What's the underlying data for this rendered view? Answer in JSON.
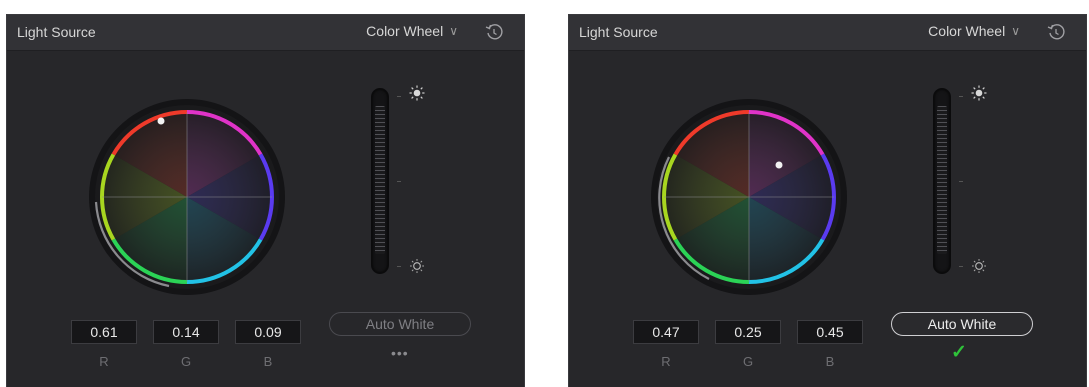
{
  "colors": {
    "panel_bg": "#27272a",
    "header_bg": "#323236",
    "check_color": "#2fc23a"
  },
  "panels": [
    {
      "title": "Light Source",
      "mode": "Color Wheel",
      "values": {
        "r": "0.61",
        "g": "0.14",
        "b": "0.09"
      },
      "channels": {
        "r": "R",
        "g": "G",
        "b": "B"
      },
      "auto_white_label": "Auto White",
      "auto_white_active": false,
      "status_icon": "more-dots-icon",
      "status_text": "•••"
    },
    {
      "title": "Light Source",
      "mode": "Color Wheel",
      "values": {
        "r": "0.47",
        "g": "0.25",
        "b": "0.45"
      },
      "channels": {
        "r": "R",
        "g": "G",
        "b": "B"
      },
      "auto_white_label": "Auto White",
      "auto_white_active": true,
      "status_icon": "checkmark-icon",
      "status_text": "✓"
    }
  ]
}
